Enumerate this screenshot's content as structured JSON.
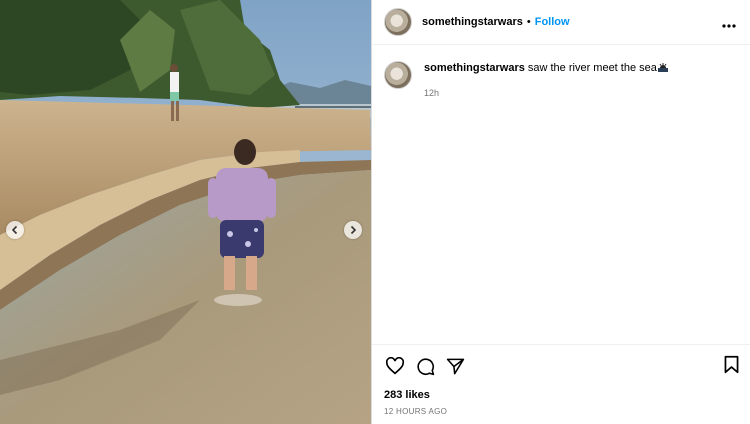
{
  "post": {
    "username": "somethingstarwars",
    "follow_label": "Follow",
    "separator": "•",
    "caption_user": "somethingstarwars",
    "caption_text": "saw the river meet the sea",
    "caption_emoji": "ocean-sunrise-emoji",
    "caption_time": "12h",
    "likes": "283 likes",
    "posted_ago": "12 HOURS AGO"
  },
  "icons": {
    "more": "more-horizontal-icon",
    "like": "heart-icon",
    "comment": "comment-bubble-icon",
    "share": "paper-plane-icon",
    "save": "bookmark-icon",
    "prev": "chevron-left-icon",
    "next": "chevron-right-icon"
  },
  "colors": {
    "follow": "#0095f6",
    "muted": "#737373",
    "border": "#dbdbdb"
  }
}
